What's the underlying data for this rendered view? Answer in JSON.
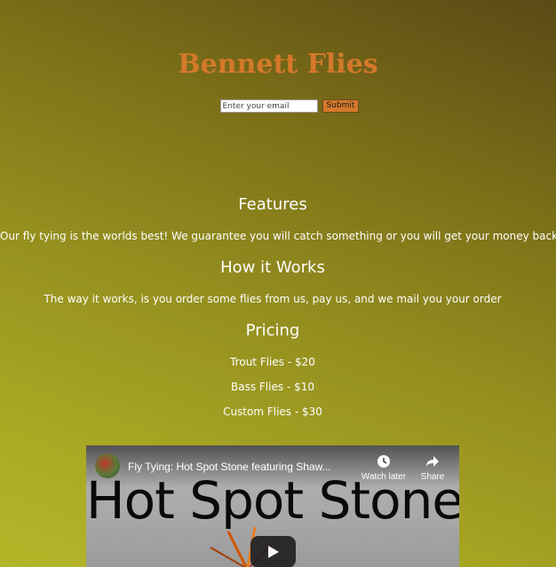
{
  "header": {
    "title": "Bennett Flies"
  },
  "signup": {
    "email_placeholder": "Enter your email",
    "submit_label": "Submit"
  },
  "features": {
    "heading": "Features",
    "text": "Our fly tying is the worlds best! We guarantee you will catch something or you will get your money back"
  },
  "how_it_works": {
    "heading": "How it Works",
    "text": "The way it works, is you order some flies from us, pay us, and we mail you your order"
  },
  "pricing": {
    "heading": "Pricing",
    "items": [
      "Trout Flies - $20",
      "Bass Flies - $10",
      "Custom Flies - $30"
    ]
  },
  "video": {
    "title": "Fly Tying: Hot Spot Stone featuring Shaw...",
    "thumbnail_text": "Hot Spot Stone",
    "watch_later_label": "Watch later",
    "share_label": "Share",
    "icons": [
      "clock-icon",
      "share-icon",
      "play-icon"
    ]
  },
  "colors": {
    "title": "#d4782a",
    "submit_bg": "#d4782a",
    "text": "#ffffff"
  }
}
